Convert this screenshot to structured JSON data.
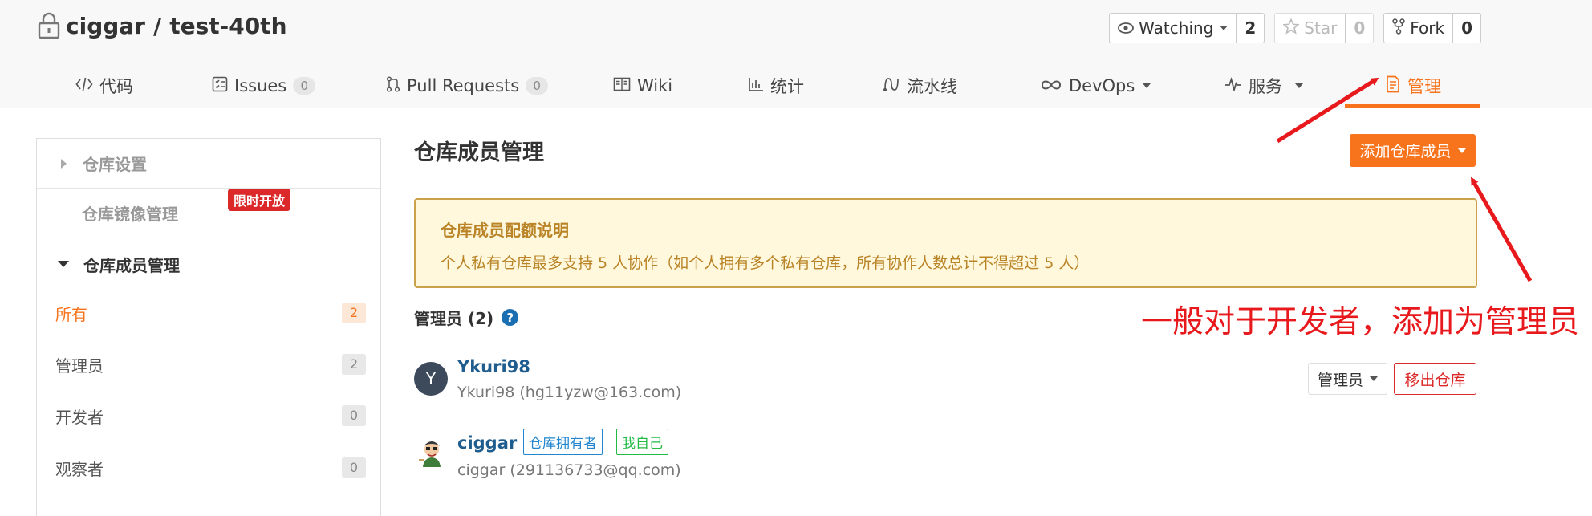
{
  "repo": {
    "owner": "ciggar",
    "separator": "/",
    "name": "test-40th"
  },
  "actions": {
    "watching": {
      "label": "Watching",
      "count": "2"
    },
    "star": {
      "label": "Star",
      "count": "0"
    },
    "fork": {
      "label": "Fork",
      "count": "0"
    }
  },
  "tabs": [
    {
      "label": "代码",
      "icon": "code-icon"
    },
    {
      "label": "Issues",
      "icon": "issues-icon",
      "count": "0"
    },
    {
      "label": "Pull Requests",
      "icon": "pull-request-icon",
      "count": "0"
    },
    {
      "label": "Wiki",
      "icon": "book-icon"
    },
    {
      "label": "统计",
      "icon": "bar-chart-icon"
    },
    {
      "label": "流水线",
      "icon": "pipeline-icon"
    },
    {
      "label": "DevOps",
      "icon": "infinity-icon"
    },
    {
      "label": "服务",
      "icon": "pulse-icon"
    },
    {
      "label": "管理",
      "icon": "settings-doc-icon",
      "active": true
    }
  ],
  "sidebar": {
    "repo_settings": "仓库设置",
    "mirror": "仓库镜像管理",
    "limited_badge": "限时开放",
    "members_section": "仓库成员管理",
    "items": [
      {
        "label": "所有",
        "count": "2",
        "active": true
      },
      {
        "label": "管理员",
        "count": "2"
      },
      {
        "label": "开发者",
        "count": "0"
      },
      {
        "label": "观察者",
        "count": "0"
      }
    ]
  },
  "main": {
    "title": "仓库成员管理",
    "add_button": "添加仓库成员",
    "notice": {
      "title": "仓库成员配额说明",
      "text": "个人私有仓库最多支持 5 人协作（如个人拥有多个私有仓库，所有协作人数总计不得超过 5 人）"
    },
    "admins_heading": "管理员 (2)",
    "help": "?",
    "members": [
      {
        "initial": "Y",
        "name": "Ykuri98",
        "sub": "Ykuri98 (hg11yzw@163.com)",
        "role": "管理员",
        "remove": "移出仓库"
      },
      {
        "name": "ciggar",
        "sub": "ciggar (291136733@qq.com)",
        "tags": [
          "仓库拥有者",
          "我自己"
        ]
      }
    ]
  },
  "annotation": "一般对于开发者，添加为管理员",
  "colors": {
    "accent": "#f7741d",
    "annotation": "#e8191c",
    "link": "#1f5d8e",
    "danger": "#db2828"
  }
}
